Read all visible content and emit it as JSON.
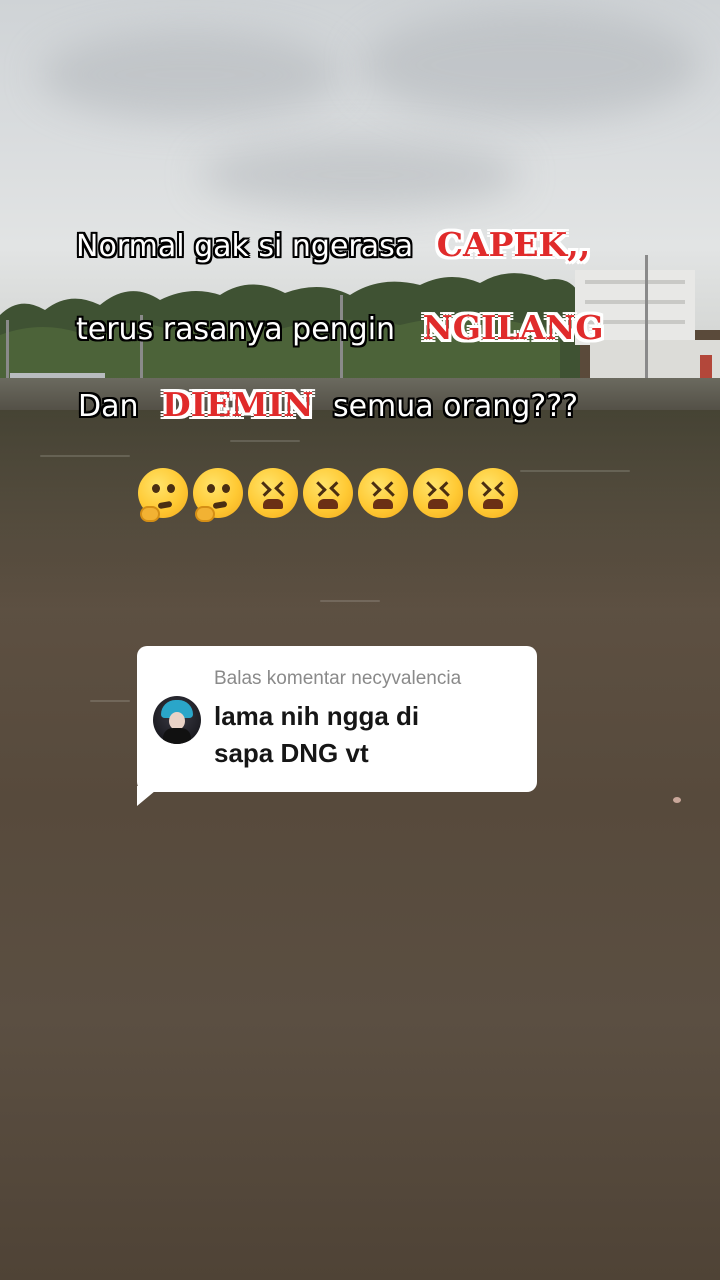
{
  "caption": {
    "line1_text": "Normal gak si ngerasa",
    "line1_highlight": "CAPEK,,",
    "line2_text": "terus rasanya pengin",
    "line2_highlight": "NGILANG",
    "line3_prefix": "Dan",
    "line3_highlight": "DIEMIN",
    "line3_suffix": "semua orang???",
    "highlight_color": "#e02b2b"
  },
  "emojis": [
    "thinking-face",
    "thinking-face",
    "tired-face",
    "tired-face",
    "tired-face",
    "tired-face",
    "tired-face"
  ],
  "reply": {
    "header": "Balas komentar necyvalencia",
    "text_line1": "lama nih ngga di",
    "text_line2": "sapa DNG vt"
  }
}
